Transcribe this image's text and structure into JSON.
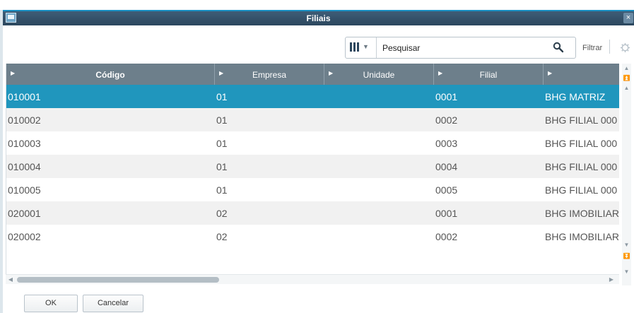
{
  "dialog": {
    "title": "Filiais",
    "close_label": "×"
  },
  "toolbar": {
    "search_placeholder": "Pesquisar",
    "search_value": "",
    "filter_label": "Filtrar"
  },
  "table": {
    "columns": [
      {
        "label": "Código"
      },
      {
        "label": "Empresa"
      },
      {
        "label": "Unidade"
      },
      {
        "label": "Filial"
      },
      {
        "label": ""
      }
    ],
    "rows": [
      {
        "codigo": "010001",
        "empresa": "01",
        "unidade": "",
        "filial": "0001",
        "nome": "BHG MATRIZ"
      },
      {
        "codigo": "010002",
        "empresa": "01",
        "unidade": "",
        "filial": "0002",
        "nome": "BHG FILIAL 000"
      },
      {
        "codigo": "010003",
        "empresa": "01",
        "unidade": "",
        "filial": "0003",
        "nome": "BHG FILIAL 000"
      },
      {
        "codigo": "010004",
        "empresa": "01",
        "unidade": "",
        "filial": "0004",
        "nome": "BHG FILIAL 000"
      },
      {
        "codigo": "010005",
        "empresa": "01",
        "unidade": "",
        "filial": "0005",
        "nome": "BHG FILIAL 000"
      },
      {
        "codigo": "020001",
        "empresa": "02",
        "unidade": "",
        "filial": "0001",
        "nome": "BHG IMOBILIAR"
      },
      {
        "codigo": "020002",
        "empresa": "02",
        "unidade": "",
        "filial": "0002",
        "nome": "BHG IMOBILIAR"
      }
    ],
    "selected_row": 0
  },
  "footer": {
    "ok_label": "OK",
    "cancel_label": "Cancelar"
  },
  "colors": {
    "title_bar": "#2c475e",
    "header_bg": "#6d7f8b",
    "selected_row": "#2096bd",
    "alt_row": "#f1f1f1"
  }
}
